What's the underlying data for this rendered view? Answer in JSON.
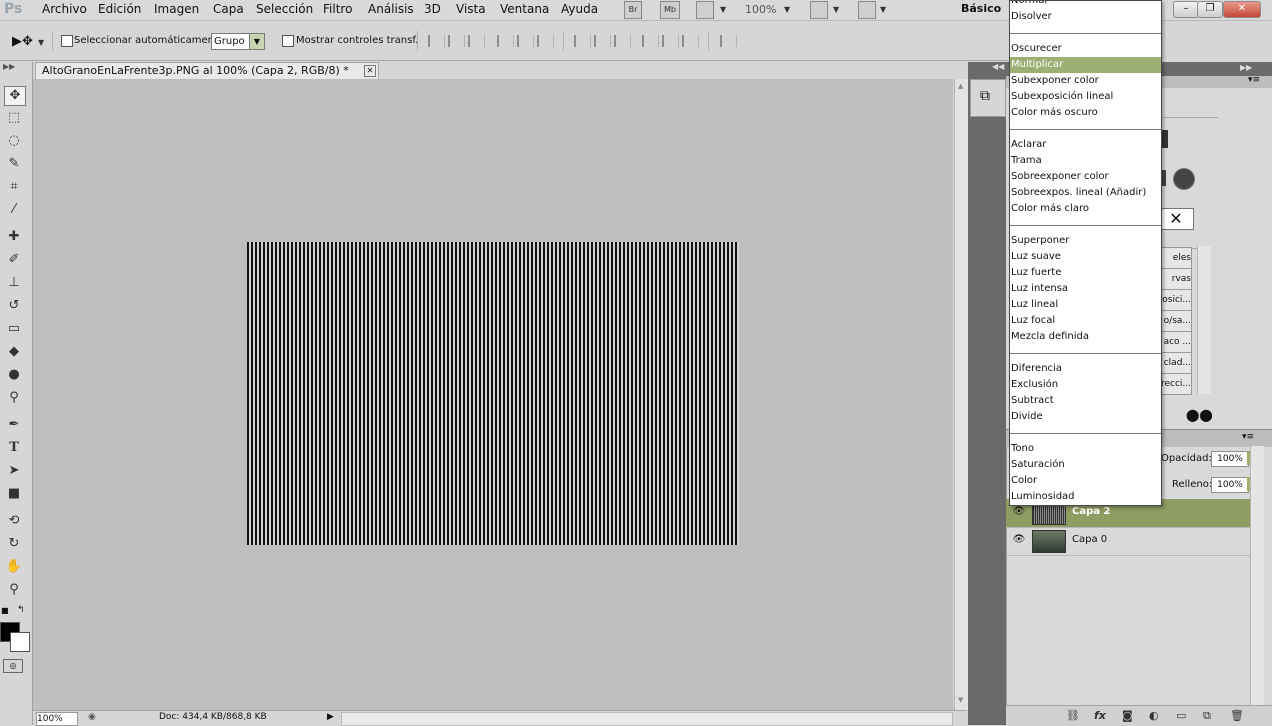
{
  "menubar": {
    "items": [
      "Archivo",
      "Edición",
      "Imagen",
      "Capa",
      "Selección",
      "Filtro",
      "Análisis",
      "3D",
      "Vista",
      "Ventana",
      "Ayuda"
    ],
    "bridge_label": "Br",
    "minibridge_label": "Mb",
    "zoom": "100%",
    "workspace": "Básico"
  },
  "optionsbar": {
    "auto_select_label": "Seleccionar automáticamente:",
    "auto_select_value": "Grupo",
    "show_transform_label": "Mostrar controles transf."
  },
  "document": {
    "tab_title": "AltoGranoEnLaFrente3p.PNG al 100% (Capa 2, RGB/8) *",
    "status_zoom": "100%",
    "status_doc": "Doc: 434,4 KB/868,8 KB"
  },
  "blend_menu": {
    "items": [
      "Normal",
      "Disolver",
      "Oscurecer",
      "Multiplicar",
      "Subexponer color",
      "Subexposición lineal",
      "Color más oscuro",
      "Aclarar",
      "Trama",
      "Sobreexponer color",
      "Sobreexpos. lineal (Añadir)",
      "Color más claro",
      "Superponer",
      "Luz suave",
      "Luz fuerte",
      "Luz intensa",
      "Luz lineal",
      "Luz focal",
      "Mezcla definida",
      "Diferencia",
      "Exclusión",
      "Subtract",
      "Divide",
      "Tono",
      "Saturación",
      "Color",
      "Luminosidad"
    ],
    "selected": "Multiplicar"
  },
  "adjustments": {
    "items": [
      "eles",
      "rvas",
      "osici...",
      "o/sa...",
      "aco ...",
      "clad...",
      "recci..."
    ]
  },
  "layers": {
    "opacity_label": "Opacidad:",
    "opacity_value": "100%",
    "fill_label": "Relleno:",
    "fill_value": "100%",
    "rows": [
      {
        "name": "Capa 2",
        "selected": true
      },
      {
        "name": "Capa 0",
        "selected": false
      }
    ]
  },
  "colors": {
    "foreground": "#000000",
    "background": "#ffffff",
    "selection_accent": "#9cb073"
  }
}
